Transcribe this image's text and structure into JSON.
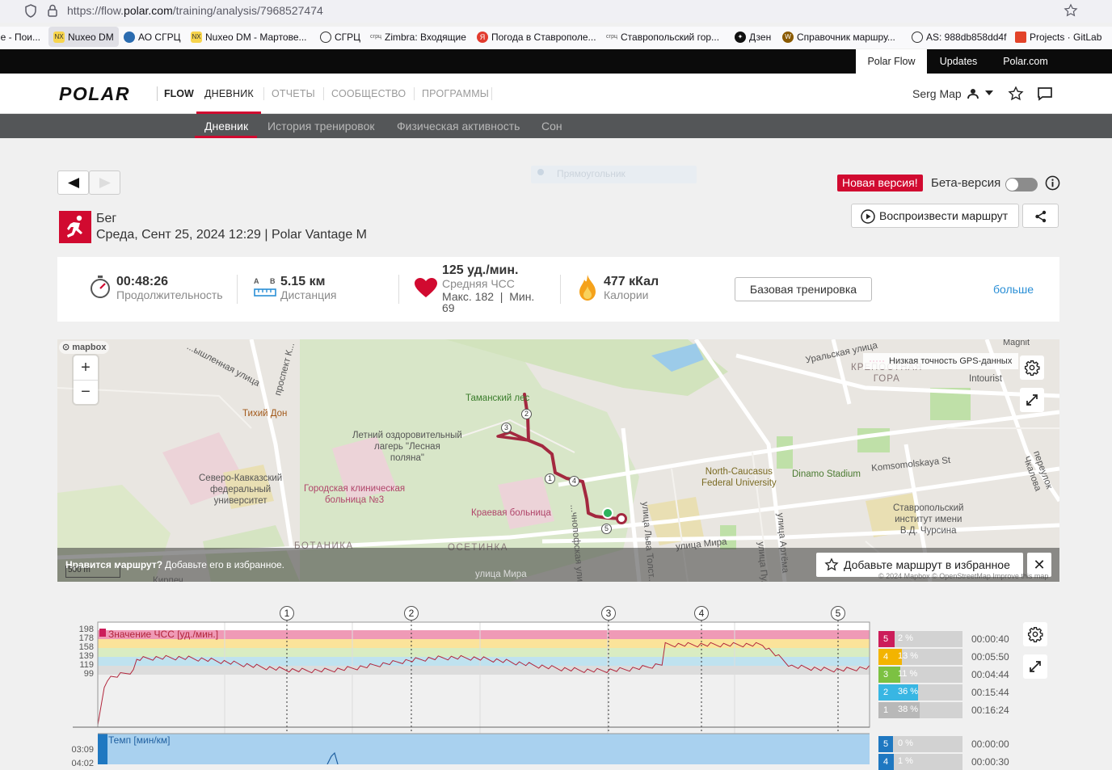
{
  "browser": {
    "url_prefix": "https://flow.",
    "url_host": "polar.com",
    "url_path": "/training/analysis/7968527474",
    "bookmarks": [
      {
        "label": "le - Пои...",
        "icon": "google-icon"
      },
      {
        "label": "Nuxeo DM",
        "icon": "nuxeo-icon"
      },
      {
        "label": "АО СГРЦ",
        "icon": "sgrc-icon"
      },
      {
        "label": "Nuxeo DM - Мартове...",
        "icon": "nuxeo-icon"
      },
      {
        "label": "СГРЦ",
        "icon": "globe-icon"
      },
      {
        "label": "Zimbra: Входящие",
        "icon": "zimbra-icon"
      },
      {
        "label": "Погода в Ставрополе...",
        "icon": "yandex-icon"
      },
      {
        "label": "Ставропольский гор...",
        "icon": "sgrc-icon"
      },
      {
        "label": "Дзен",
        "icon": "dzen-icon"
      },
      {
        "label": "Справочник маршру...",
        "icon": "w-icon"
      },
      {
        "label": "AS: 988db858dd4f",
        "icon": "globe-icon"
      },
      {
        "label": "Projects · GitLab",
        "icon": "gitlab-icon"
      }
    ]
  },
  "topbar": {
    "polar_flow": "Polar Flow",
    "updates": "Updates",
    "polar_com": "Polar.com"
  },
  "header": {
    "logo": "POLAR",
    "flow": "FLOW",
    "nav": [
      "ДНЕВНИК",
      "ОТЧЕТЫ",
      "СООБЩЕСТВО",
      "ПРОГРАММЫ"
    ],
    "user": "Serg Map"
  },
  "subnav": [
    "Дневник",
    "История тренировок",
    "Физическая активность",
    "Сон"
  ],
  "ghost_label": "Прямоугольник",
  "beta": {
    "new_version": "Новая версия!",
    "beta_label": "Бета-версия"
  },
  "session": {
    "sport": "Бег",
    "datetime": "Среда, Сент 25, 2024 12:29 | Polar Vantage M",
    "replay": "Воспроизвести маршрут"
  },
  "stats": {
    "duration_value": "00:48:26",
    "duration_label": "Продолжительность",
    "distance_value": "5.15 км",
    "distance_label": "Дистанция",
    "ab_a": "A",
    "ab_b": "B",
    "hr_value": "125 уд./мин.",
    "hr_label": "Средняя ЧСС",
    "hr_minmax_1": "Макс. 182  |  Мин.",
    "hr_minmax_2": "69",
    "cal_value": "477 кКал",
    "cal_label": "Калории",
    "base_training": "Базовая тренировка",
    "more": "больше"
  },
  "map": {
    "mapbox": "mapbox",
    "legend": "Низкая точность GPS-данных",
    "like_q": "Нравится маршрут?",
    "like_text": "Добавьте его в избранное.",
    "fav_button": "Добавьте маршрут в избранное",
    "scale": "500 m",
    "attribution": "© 2024 Mapbox © OpenStreetMap Improve this map",
    "labels": [
      {
        "text": "Magnit"
      },
      {
        "text": "Уральская улица"
      },
      {
        "text": "КРЕПОСТНАЯ\nГОРА"
      },
      {
        "text": "Intourist"
      },
      {
        "text": "Таманский лес"
      },
      {
        "text": "Тихий Дон"
      },
      {
        "text": "Летний оздоровительный\nлагерь \"Лесная\nполяна\""
      },
      {
        "text": "Северо-Кавказский\nфедеральный\nуниверситет"
      },
      {
        "text": "Городская клиническая\nбольница №3"
      },
      {
        "text": "Краевая больница"
      },
      {
        "text": "North-Caucasus\nFederal University"
      },
      {
        "text": "Dinamo Stadium"
      },
      {
        "text": "Komsomolskaya St"
      },
      {
        "text": "Ставропольский\nинститут имени\nВ.Д. Чурсина"
      },
      {
        "text": "БОТАНИКА"
      },
      {
        "text": "ОСЕТИНКА"
      },
      {
        "text": "улица Мира"
      },
      {
        "text": "улица Мира"
      },
      {
        "text": "проспект К..."
      },
      {
        "text": "...ышленная улица"
      },
      {
        "text": "переулок Чкалова"
      },
      {
        "text": "улица Артёма"
      },
      {
        "text": "улица Льва Толст..."
      },
      {
        "text": "...чнопофская ули..."
      },
      {
        "text": "Кирпеч..."
      },
      {
        "text": "улица Пу..."
      }
    ],
    "laps": [
      "1",
      "2",
      "3",
      "4",
      "5"
    ]
  },
  "hr_chart": {
    "label": "Значение ЧСС [уд./мин.]",
    "ticks": [
      "198",
      "178",
      "158",
      "139",
      "119",
      "99"
    ],
    "laps": [
      "1",
      "2",
      "3",
      "4",
      "5"
    ],
    "zone_colors": [
      "#ef9ab6",
      "#fbe39a",
      "#d9ecc2",
      "#bfe2ef",
      "#dcdcdc"
    ],
    "series_color": "#b2263c",
    "zones": [
      {
        "num": "5",
        "pct": "2 %",
        "pct_value": 2,
        "time": "00:00:40",
        "color": "#cc1d5a"
      },
      {
        "num": "4",
        "pct": "13 %",
        "pct_value": 13,
        "time": "00:05:50",
        "color": "#f3b400"
      },
      {
        "num": "3",
        "pct": "11 %",
        "pct_value": 11,
        "time": "00:04:44",
        "color": "#7cc142"
      },
      {
        "num": "2",
        "pct": "36 %",
        "pct_value": 36,
        "time": "00:15:44",
        "color": "#38b6e3"
      },
      {
        "num": "1",
        "pct": "38 %",
        "pct_value": 38,
        "time": "00:16:24",
        "color": "#b8b8b8"
      }
    ]
  },
  "pace_chart": {
    "label": "Темп [мин/км]",
    "ticks": [
      "03:09",
      "04:02"
    ],
    "zones": [
      {
        "num": "5",
        "pct": "0 %",
        "pct_value": 0,
        "time": "00:00:00",
        "color": "#1f78c1"
      },
      {
        "num": "4",
        "pct": "1 %",
        "pct_value": 1,
        "time": "00:00:30",
        "color": "#1f78c1"
      }
    ]
  },
  "colors": {
    "polar_red": "#d10a30",
    "link_blue": "#2a8fd6"
  }
}
